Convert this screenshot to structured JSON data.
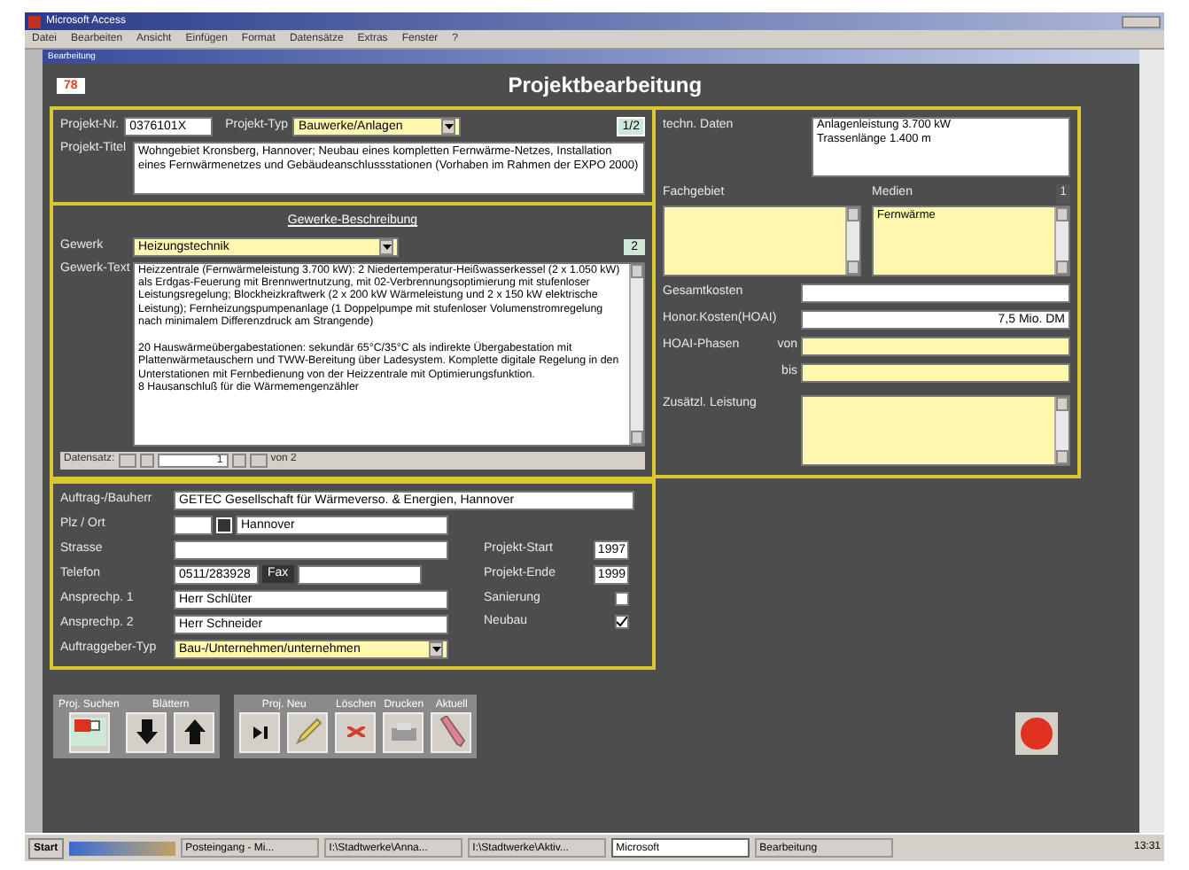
{
  "window": {
    "title": "Microsoft Access"
  },
  "menu": [
    "Datei",
    "Bearbeiten",
    "Ansicht",
    "Einfügen",
    "Format",
    "Datensätze",
    "Extras",
    "Fenster",
    "?"
  ],
  "form": {
    "title": "Bearbeitung",
    "badge": "78",
    "heading": "Projektbearbeitung"
  },
  "project": {
    "number_label": "Projekt-Nr.",
    "number": "0376101X",
    "type_label": "Projekt-Typ",
    "type": "Bauwerke/Anlagen",
    "count": "1/2",
    "title_label": "Projekt-Titel",
    "title": "Wohngebiet Kronsberg, Hannover; Neubau eines kompletten Fernwärme-Netzes, Installation eines Fernwärmenetzes und Gebäudeanschlussstationen (Vorhaben im Rahmen der EXPO 2000)"
  },
  "trades": {
    "heading": "Gewerke-Beschreibung",
    "trade_label": "Gewerk",
    "trade": "Heizungstechnik",
    "count": "2",
    "text_label": "Gewerk-Text",
    "text": "Heizzentrale (Fernwärmeleistung 3.700 kW): 2 Niedertemperatur-Heißwasserkessel (2 x 1.050 kW) als Erdgas-Feuerung mit Brennwertnutzung, mit 02-Verbrennungsoptimierung mit stufenloser Leistungsregelung; Blockheizkraftwerk (2 x 200 kW Wärmeleistung und 2 x 150 kW elektrische Leistung); Fernheizungspumpenanlage (1 Doppelpumpe mit stufenloser Volumenstromregelung nach minimalem Differenzdruck am Strangende)\n\n20 Hauswärmeübergabestationen: sekundär 65°C/35°C als indirekte Übergabestation mit Plattenwärmetauschern und TWW-Bereitung über Ladesystem. Komplette digitale Regelung in den Unterstationen mit Fernbedienung von der Heizzentrale mit Optimierungsfunktion.\n8 Hausanschluß für die Wärmemengenzähler"
  },
  "record_nav": {
    "label": "Datensatz:",
    "current": "1",
    "total": "von 2"
  },
  "technical": {
    "data_label": "techn. Daten",
    "data": "Anlagenleistung 3.700 kW\nTrassenlänge 1.400 m",
    "field_label": "Fachgebiet",
    "media_label": "Medien",
    "media_count": "1",
    "media": [
      "Fernwärme"
    ],
    "cost_label": "Gesamtkosten",
    "fee_label": "Honor.Kosten(HOAI)",
    "fee": "7,5 Mio. DM",
    "phase_label": "HOAI-Phasen",
    "from_label": "von",
    "to_label": "bis",
    "extra_label": "Zusätzl. Leistung"
  },
  "client": {
    "rows": [
      {
        "label": "Auftrag-/Bauherr",
        "value": "GETEC Gesellschaft für Wärmeverso. & Energien, Hannover"
      },
      {
        "label": "Plz / Ort",
        "value": "Hannover"
      },
      {
        "label": "Strasse"
      },
      {
        "label": "Telefon",
        "value": "0511/283928",
        "fax_label": "Fax"
      },
      {
        "label": "Ansprechp. 1",
        "value": "Herr Schlüter"
      },
      {
        "label": "Ansprechp. 2",
        "value": "Herr Schneider"
      },
      {
        "label": "Auftraggeber-Typ",
        "value": "Bau-/Unternehmen/unternehmen"
      }
    ],
    "side": [
      {
        "kind": "text",
        "label": "Projekt-Start",
        "value": "1997"
      },
      {
        "kind": "text",
        "label": "Projekt-Ende",
        "value": "1999"
      },
      {
        "kind": "check",
        "label": "Sanierung",
        "checked": false
      },
      {
        "kind": "check",
        "label": "Neubau",
        "checked": true
      }
    ]
  },
  "toolbars": [
    {
      "sections": [
        {
          "label": "Proj. Suchen",
          "buttons": [
            {
              "kind": "find"
            }
          ]
        },
        {
          "label": "Blättern",
          "buttons": [
            {
              "kind": "down"
            },
            {
              "kind": "up"
            }
          ]
        }
      ]
    },
    {
      "sections": [
        {
          "label": "Proj. Neu",
          "buttons": [
            {
              "kind": "new"
            },
            {
              "kind": "edit"
            }
          ]
        },
        {
          "label": "Löschen",
          "buttons": [
            {
              "kind": "delete"
            }
          ]
        },
        {
          "label": "Drucken",
          "buttons": [
            {
              "kind": "print"
            }
          ]
        },
        {
          "label": "Aktuell",
          "buttons": [
            {
              "kind": "refresh"
            }
          ]
        }
      ]
    }
  ],
  "taskbar": {
    "start": "Start",
    "tasks": [
      {
        "label": "Posteingang - Mi...",
        "selected": false
      },
      {
        "label": "I:\\Stadtwerke\\Anna...",
        "selected": false
      },
      {
        "label": "I:\\Stadtwerke\\Aktiv...",
        "selected": false
      },
      {
        "label": "Microsoft",
        "selected": true
      },
      {
        "label": "Bearbeitung",
        "selected": false
      }
    ],
    "clock": "13:31"
  }
}
